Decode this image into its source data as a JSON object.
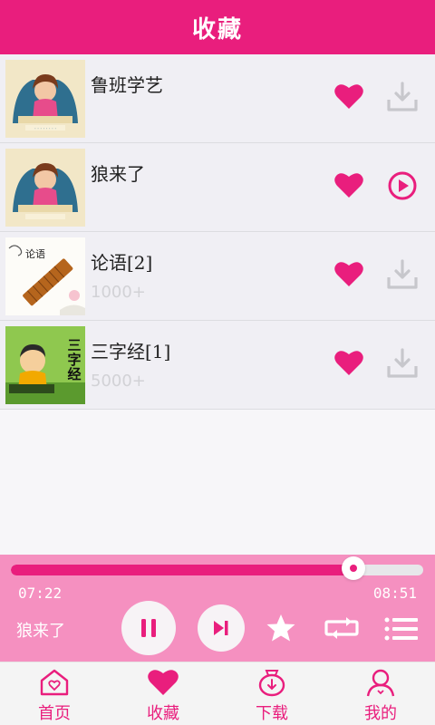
{
  "header": {
    "title": "收藏"
  },
  "colors": {
    "accent": "#e91e7d",
    "player_bg": "#f590c0",
    "muted": "#d2d2d6"
  },
  "favorites": [
    {
      "title": "鲁班学艺",
      "count": "",
      "action_icon": "download-icon"
    },
    {
      "title": "狼来了",
      "count": "",
      "action_icon": "play-circle-icon"
    },
    {
      "title": "论语[2]",
      "count": "1000+",
      "action_icon": "download-icon"
    },
    {
      "title": "三字经[1]",
      "count": "5000+",
      "action_icon": "download-icon"
    }
  ],
  "player": {
    "current_time": "07:22",
    "total_time": "08:51",
    "progress": 0.83,
    "now_playing": "狼来了",
    "controls": [
      "pause-icon",
      "next-icon",
      "star-icon",
      "repeat-icon",
      "playlist-icon"
    ]
  },
  "tabs": [
    {
      "label": "首页",
      "icon": "home-icon"
    },
    {
      "label": "收藏",
      "icon": "heart-icon",
      "active": true
    },
    {
      "label": "下载",
      "icon": "download-bag-icon"
    },
    {
      "label": "我的",
      "icon": "user-icon"
    }
  ]
}
